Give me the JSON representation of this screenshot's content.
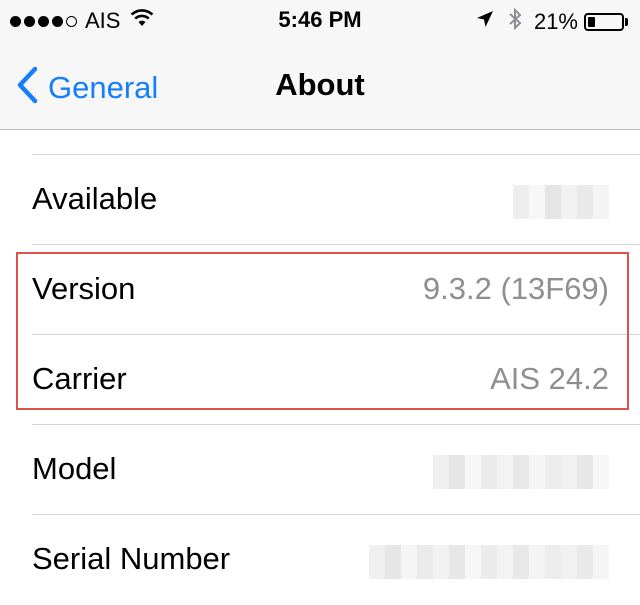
{
  "status_bar": {
    "carrier": "AIS",
    "time": "5:46 PM",
    "battery_percent": "21%",
    "battery_level": 0.21,
    "signal_bars_filled": 4,
    "signal_bars_total": 5
  },
  "nav": {
    "back_label": "General",
    "title": "About"
  },
  "rows": [
    {
      "label": "Available",
      "value": ""
    },
    {
      "label": "Version",
      "value": "9.3.2 (13F69)"
    },
    {
      "label": "Carrier",
      "value": "AIS 24.2"
    },
    {
      "label": "Model",
      "value": ""
    },
    {
      "label": "Serial Number",
      "value": ""
    }
  ],
  "colors": {
    "accent": "#147efb",
    "value_gray": "#8e8e93",
    "highlight_border": "#d9534f"
  }
}
